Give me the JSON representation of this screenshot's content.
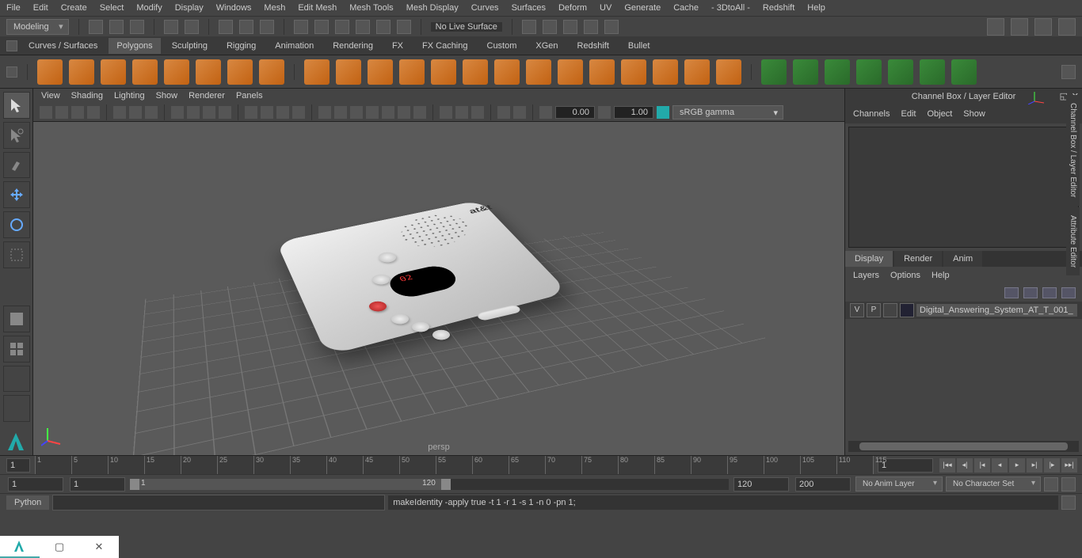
{
  "menu": [
    "File",
    "Edit",
    "Create",
    "Select",
    "Modify",
    "Display",
    "Windows",
    "Mesh",
    "Edit Mesh",
    "Mesh Tools",
    "Mesh Display",
    "Curves",
    "Surfaces",
    "Deform",
    "UV",
    "Generate",
    "Cache",
    "- 3DtoAll -",
    "Redshift",
    "Help"
  ],
  "workspace": "Modeling",
  "status_line": {
    "no_live_surface": "No Live Surface"
  },
  "shelves": [
    "Curves / Surfaces",
    "Polygons",
    "Sculpting",
    "Rigging",
    "Animation",
    "Rendering",
    "FX",
    "FX Caching",
    "Custom",
    "XGen",
    "Redshift",
    "Bullet"
  ],
  "active_shelf": "Polygons",
  "viewport_menus": [
    "View",
    "Shading",
    "Lighting",
    "Show",
    "Renderer",
    "Panels"
  ],
  "viewport_params": {
    "val1": "0.00",
    "val2": "1.00",
    "colorspace": "sRGB gamma",
    "camera": "persp"
  },
  "model": {
    "brand": "at&t",
    "display_value": "02"
  },
  "channel_box": {
    "title": "Channel Box / Layer Editor",
    "tabs": [
      "Channels",
      "Edit",
      "Object",
      "Show"
    ],
    "bottom_tabs": [
      "Display",
      "Render",
      "Anim"
    ],
    "active_bottom": "Display",
    "layer_menus": [
      "Layers",
      "Options",
      "Help"
    ],
    "layer": {
      "v": "V",
      "p": "P",
      "name": "Digital_Answering_System_AT_T_001_"
    }
  },
  "side_panel_tabs": [
    "Channel Box / Layer Editor",
    "Attribute Editor"
  ],
  "timeline": {
    "ticks": [
      "1",
      "5",
      "10",
      "15",
      "20",
      "25",
      "30",
      "35",
      "40",
      "45",
      "50",
      "55",
      "60",
      "65",
      "70",
      "75",
      "80",
      "85",
      "90",
      "95",
      "100",
      "105",
      "110",
      "115"
    ],
    "current": "1",
    "start": "1",
    "inner_start": "1",
    "inner_end": "120",
    "end": "120",
    "fps_end": "200",
    "anim_layer": "No Anim Layer",
    "character": "No Character Set"
  },
  "command": {
    "lang": "Python",
    "output": "makeIdentity -apply true -t 1 -r 1 -s 1 -n 0 -pn 1;"
  }
}
